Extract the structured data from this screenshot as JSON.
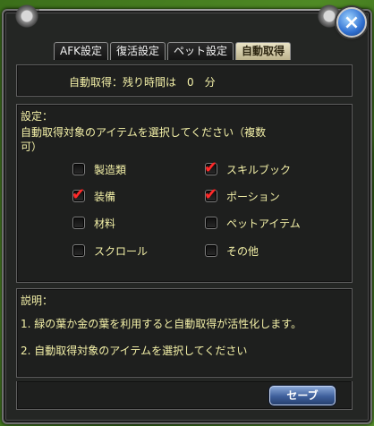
{
  "window": {
    "close_icon": "×"
  },
  "tabs": [
    {
      "label": "AFK設定"
    },
    {
      "label": "復活設定"
    },
    {
      "label": "ペット設定"
    },
    {
      "label": "自動取得"
    }
  ],
  "status": {
    "text": "自動取得：残り時間は　0　分"
  },
  "settings": {
    "heading": "設定：",
    "instruction_line1": "自動取得対象のアイテムを選択してください（複数",
    "instruction_line2": "可）",
    "items": [
      {
        "label": "製造類",
        "checked": false
      },
      {
        "label": "スキルブック",
        "checked": true
      },
      {
        "label": "装備",
        "checked": true
      },
      {
        "label": "ポーション",
        "checked": true
      },
      {
        "label": "材料",
        "checked": false
      },
      {
        "label": "ペットアイテム",
        "checked": false
      },
      {
        "label": "スクロール",
        "checked": false
      },
      {
        "label": "その他",
        "checked": false
      }
    ],
    "check_mark": "✔"
  },
  "description": {
    "heading": "説明：",
    "line1": "1. 緑の葉か金の葉を利用すると自動取得が活性化します。",
    "line2": "2. 自動取得対象のアイテムを選択してください"
  },
  "footer": {
    "save_label": "セーブ"
  }
}
